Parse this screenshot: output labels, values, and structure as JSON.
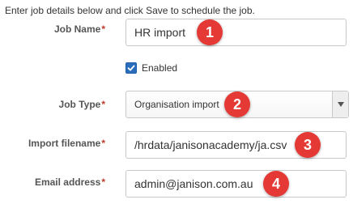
{
  "intro_text": "Enter job details below and click Save to schedule the job.",
  "required_marker": "*",
  "fields": {
    "job_name": {
      "label": "Job Name",
      "value": "HR import"
    },
    "enabled": {
      "label": "Enabled",
      "checked": true
    },
    "job_type": {
      "label": "Job Type",
      "value": "Organisation import"
    },
    "import_filename": {
      "label": "Import filename",
      "value": "/hrdata/janisonacademy/ja.csv"
    },
    "email_address": {
      "label": "Email address",
      "value": "admin@janison.com.au"
    }
  },
  "badges": [
    "1",
    "2",
    "3",
    "4"
  ],
  "colors": {
    "required": "#c0392b",
    "badge": "#e53935",
    "checkbox": "#2a6ebb",
    "label": "#555555"
  },
  "icons": {
    "checkbox": "checkmark-icon",
    "select_arrow": "caret-down-icon"
  }
}
